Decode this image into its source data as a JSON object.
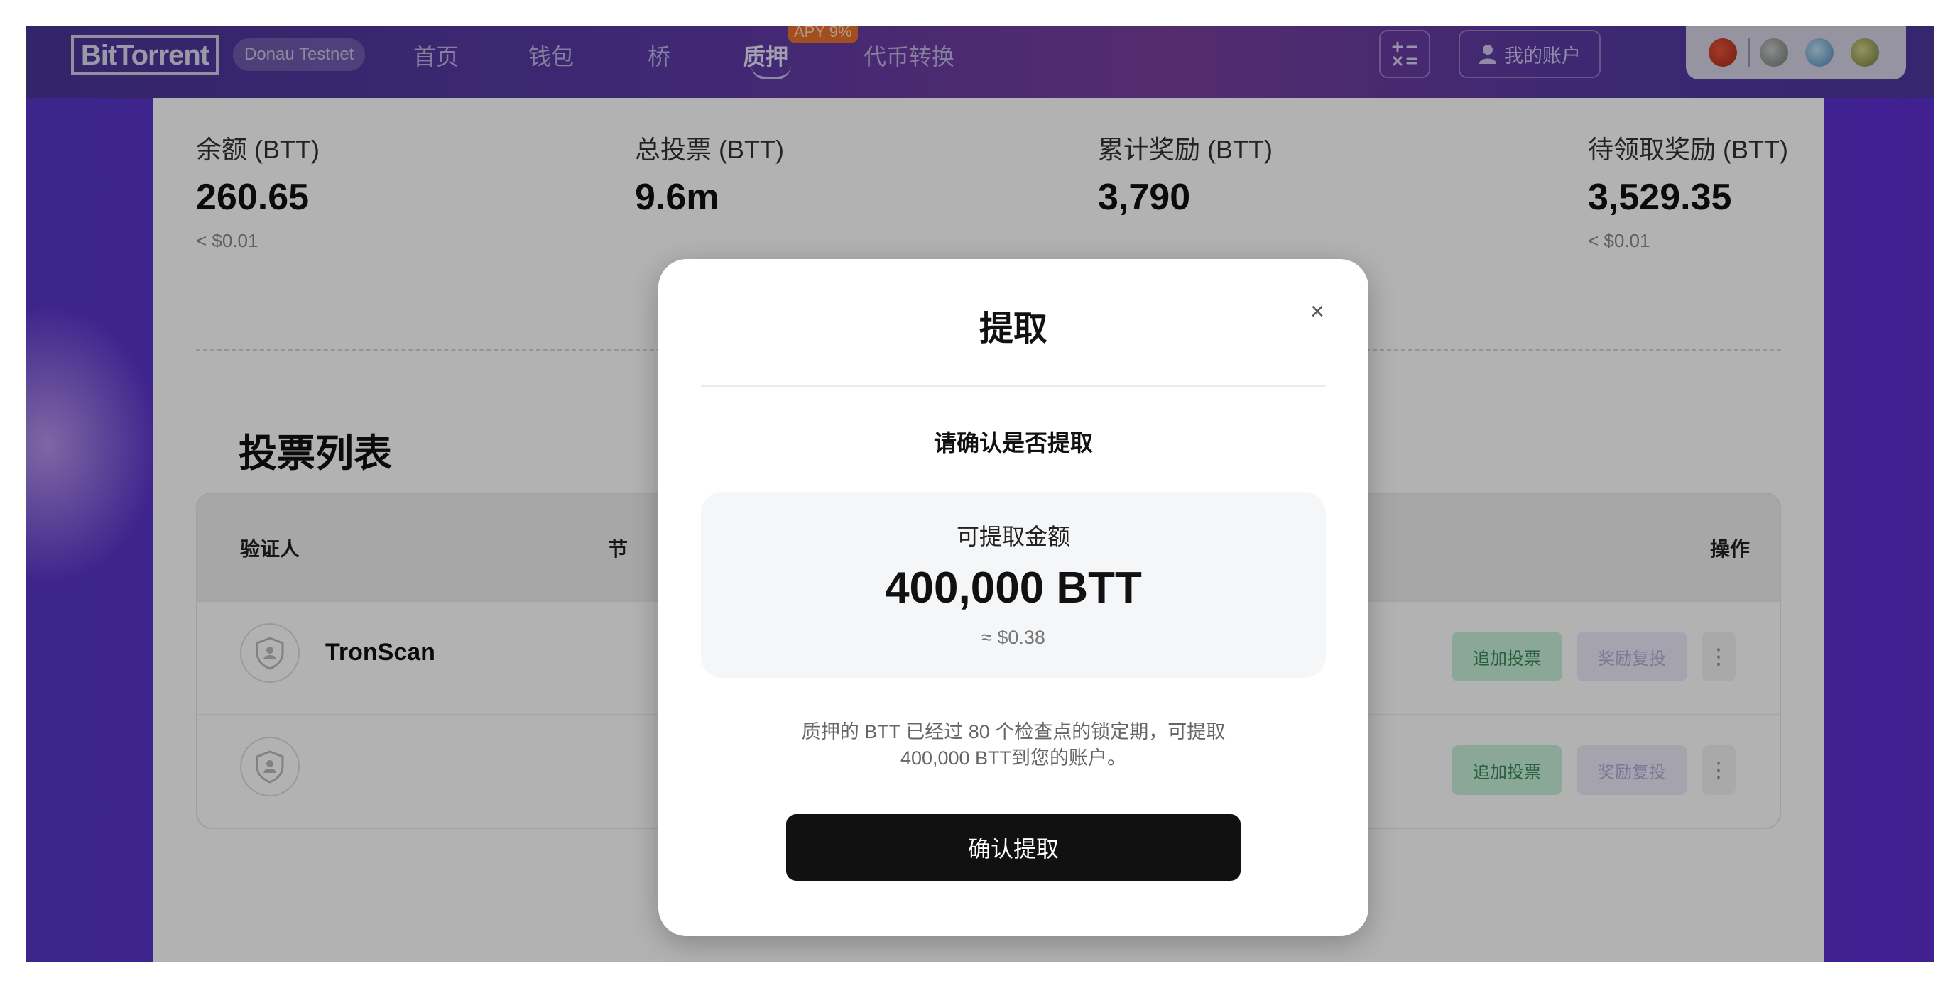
{
  "header": {
    "logo": "BitTorrent",
    "network": "Donau Testnet",
    "nav": [
      {
        "label": "首页"
      },
      {
        "label": "钱包"
      },
      {
        "label": "桥"
      },
      {
        "label": "质押",
        "badge": "APY 9%"
      },
      {
        "label": "代币转换"
      }
    ],
    "account_label": "我的账户"
  },
  "stats": [
    {
      "label": "余额 (BTT)",
      "value": "260.65",
      "usd": "< $0.01"
    },
    {
      "label": "总投票 (BTT)",
      "value": "9.6m",
      "usd": ""
    },
    {
      "label": "累计奖励 (BTT)",
      "value": "3,790",
      "usd": ""
    },
    {
      "label": "待领取奖励 (BTT)",
      "value": "3,529.35",
      "usd": "< $0.01"
    }
  ],
  "vote_list": {
    "title": "投票列表",
    "columns": {
      "validator": "验证人",
      "node": "节",
      "action": "操作"
    },
    "rows": [
      {
        "name": "TronScan",
        "vote_btn": "追加投票",
        "compound_btn": "奖励复投"
      },
      {
        "name": "",
        "vote_btn": "追加投票",
        "compound_btn": "奖励复投"
      }
    ]
  },
  "modal": {
    "title": "提取",
    "close": "×",
    "subtitle": "请确认是否提取",
    "amount_label": "可提取金额",
    "amount_value": "400,000 BTT",
    "amount_usd": "≈ $0.38",
    "note": "质押的 BTT 已经过 80 个检查点的锁定期，可提取 400,000 BTT到您的账户。",
    "confirm": "确认提取"
  },
  "colors": {
    "brand_purple": "#5534d6",
    "modal_button": "#111111",
    "vote_button_bg": "#c8f0d8",
    "compound_button_bg": "#ecebfa"
  }
}
